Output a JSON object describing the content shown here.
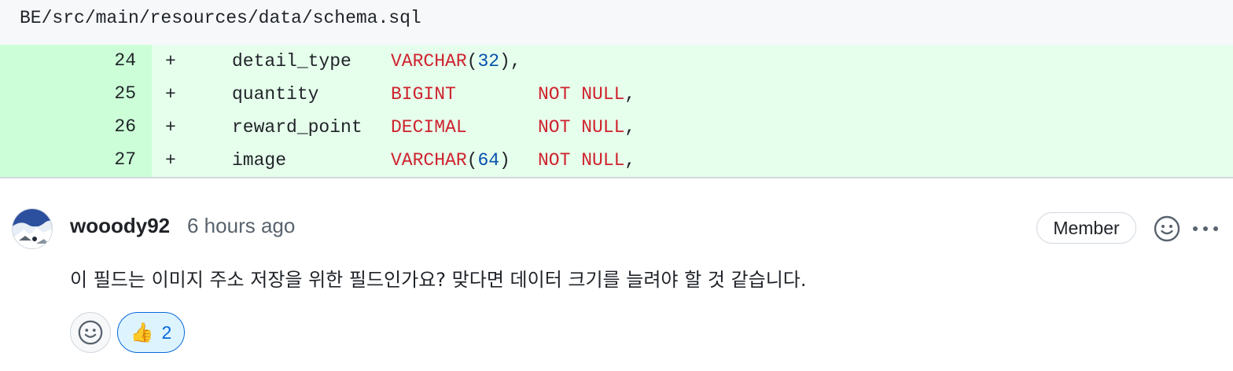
{
  "file": {
    "path": "BE/src/main/resources/data/schema.sql"
  },
  "diff": {
    "lines": [
      {
        "number": "24",
        "marker": "+",
        "column": "detail_type",
        "type": "VARCHAR",
        "type_open": "(",
        "type_arg": "32",
        "type_close": ")",
        "constraint": "",
        "trailing": ","
      },
      {
        "number": "25",
        "marker": "+",
        "column": "quantity",
        "type": "BIGINT",
        "type_open": "",
        "type_arg": "",
        "type_close": "",
        "constraint": "NOT NULL",
        "trailing": ","
      },
      {
        "number": "26",
        "marker": "+",
        "column": "reward_point",
        "type": "DECIMAL",
        "type_open": "",
        "type_arg": "",
        "type_close": "",
        "constraint": "NOT NULL",
        "trailing": ","
      },
      {
        "number": "27",
        "marker": "+",
        "column": "image",
        "type": "VARCHAR",
        "type_open": "(",
        "type_arg": "64",
        "type_close": ")",
        "constraint": "NOT NULL",
        "trailing": ","
      }
    ]
  },
  "comment": {
    "author": "wooody92",
    "timestamp": "6 hours ago",
    "role_badge": "Member",
    "body": "이 필드는 이미지 주소 저장을 위한 필드인가요? 맞다면 데이터 크기를 늘려야 할 것 같습니다.",
    "reactions": [
      {
        "emoji": "👍",
        "icon": "thumbs-up-icon",
        "count": "2"
      }
    ]
  },
  "colors": {
    "added_gutter": "#ccffd8",
    "added_line": "#e6ffec",
    "keyword": "#cf222e",
    "number": "#0550ae",
    "reaction_accent": "#0969da"
  }
}
